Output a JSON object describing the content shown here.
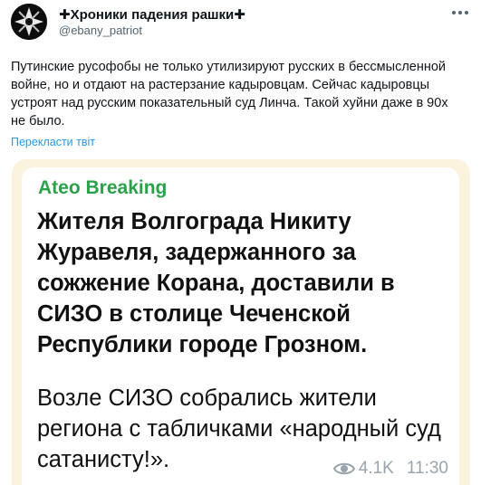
{
  "author": {
    "display_name": "✚Хроники падения рашки✚",
    "handle": "@ebany_patriot",
    "avatar_icon": "black-white-emblem"
  },
  "tweet": {
    "text": "Путинские русофобы не только утилизируют русских в бессмысленной войне, но и отдают на растерзание кадыровцам. Сейчас кадыровцы устроят над русским показательный суд Линча. Такой хуйни даже в 90х не было.",
    "translate_label": "Перекласти твіт"
  },
  "embedded_post": {
    "channel": "Ateo Breaking",
    "headline": "Жителя Волгограда Никиту Журавеля, задержанного за сожжение Корана, доставили в СИЗО в столице Чеченской Республики городе Грозном.",
    "body": "Возле СИЗО собрались жители региона с табличками «народный суд сатанисту!».",
    "views": "4.1K",
    "time": "11:30",
    "views_icon": "eye-icon"
  },
  "colors": {
    "link": "#1d9bf0",
    "channel": "#2aa24a",
    "card_background": "#fbf3de"
  }
}
